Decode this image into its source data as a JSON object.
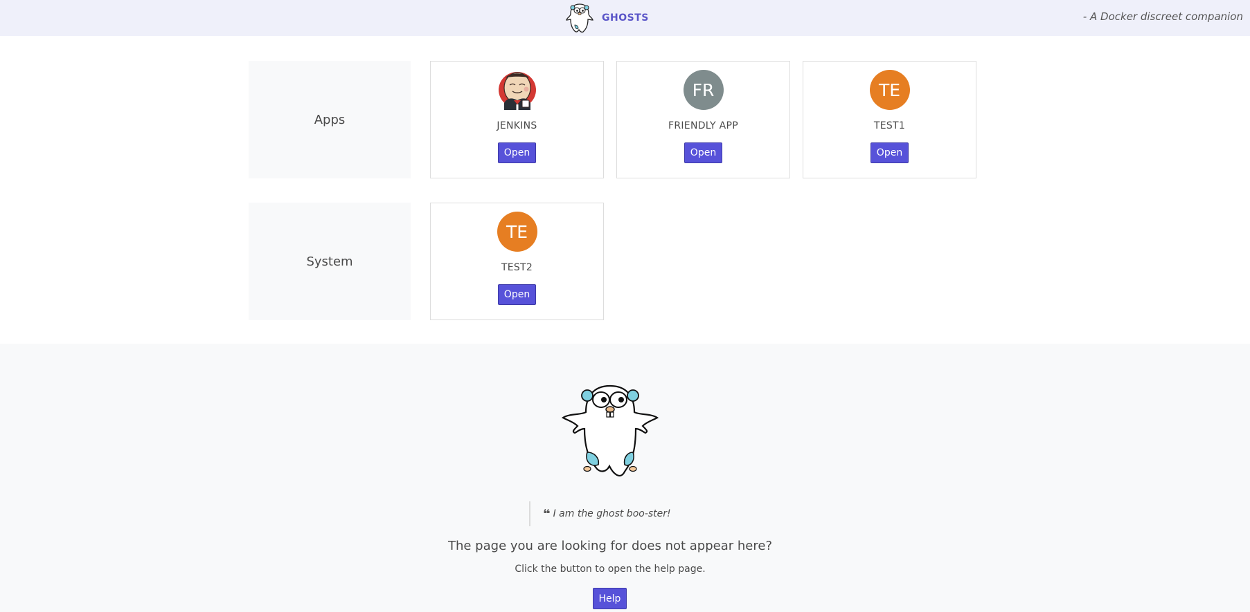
{
  "header": {
    "brand_name": "GHOSTS",
    "tagline": "- A Docker discreet companion",
    "logo_icon": "ghost-gopher-icon"
  },
  "sections": [
    {
      "label": "Apps",
      "cards": [
        {
          "name": "JENKINS",
          "icon": "jenkins-logo-icon",
          "button": "Open"
        },
        {
          "name": "FRIENDLY APP",
          "initials": "FR",
          "color": "#7f8c8d",
          "button": "Open"
        },
        {
          "name": "TEST1",
          "initials": "TE",
          "color": "#e67e22",
          "button": "Open"
        }
      ]
    },
    {
      "label": "System",
      "cards": [
        {
          "name": "TEST2",
          "initials": "TE",
          "color": "#e67e22",
          "button": "Open"
        }
      ]
    }
  ],
  "footer": {
    "mascot_icon": "ghost-gopher-icon",
    "quote": "I am the ghost boo-ster!",
    "title": "The page you are looking for does not appear here?",
    "subtitle": "Click the button to open the help page.",
    "help_label": "Help"
  },
  "colors": {
    "accent": "#5752d9",
    "navbar_bg": "#eff0fa",
    "brand": "#5a55c8",
    "grey_avatar": "#7f8c8d",
    "orange_avatar": "#e67e22"
  }
}
